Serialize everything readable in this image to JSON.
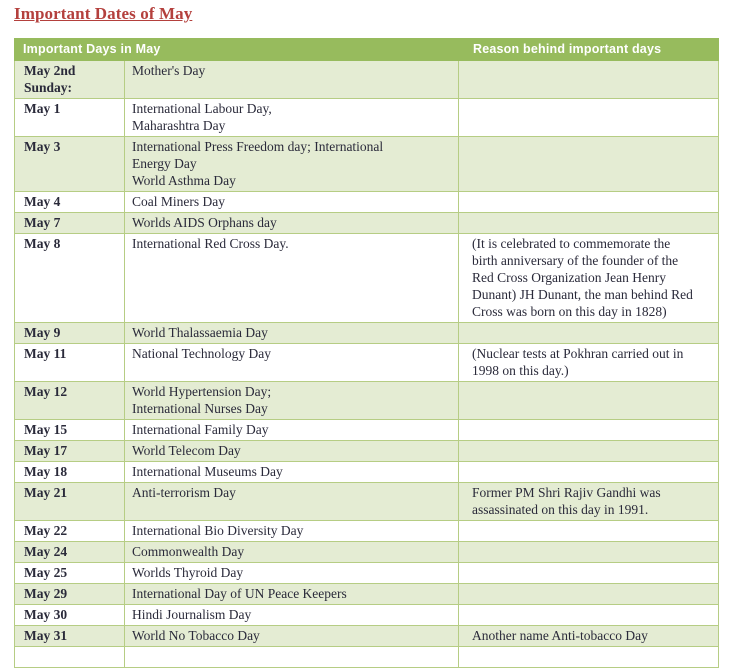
{
  "page": {
    "title": "Important Dates of May"
  },
  "table": {
    "columns": [
      {
        "key": "date",
        "label": "Important Days in May"
      },
      {
        "key": "event",
        "label": ""
      },
      {
        "key": "reason",
        "label": "Reason behind  important days"
      }
    ],
    "rows": [
      {
        "shade": true,
        "date": [
          "May 2nd",
          "Sunday:"
        ],
        "event": [
          "Mother's Day"
        ],
        "reason": []
      },
      {
        "shade": false,
        "date": [
          "May 1"
        ],
        "event": [
          "International Labour Day,",
          "Maharashtra Day"
        ],
        "reason": []
      },
      {
        "shade": true,
        "date": [
          "May 3"
        ],
        "event": [
          "International Press Freedom day; International",
          "Energy Day",
          "World Asthma Day"
        ],
        "reason": []
      },
      {
        "shade": false,
        "date": [
          "May 4"
        ],
        "event": [
          "Coal Miners Day"
        ],
        "reason": []
      },
      {
        "shade": true,
        "date": [
          "May 7"
        ],
        "event": [
          "Worlds AIDS Orphans day"
        ],
        "reason": []
      },
      {
        "shade": false,
        "date": [
          "May 8"
        ],
        "event": [
          "International Red Cross Day."
        ],
        "reason": [
          "(It is celebrated to commemorate the",
          "birth anniversary of the founder of the",
          "Red Cross Organization Jean Henry",
          "Dunant) JH Dunant, the man behind Red",
          "Cross was born on this day in 1828)"
        ]
      },
      {
        "shade": true,
        "date": [
          "May 9"
        ],
        "event": [
          "World Thalassaemia Day"
        ],
        "reason": []
      },
      {
        "shade": false,
        "date": [
          "May 11"
        ],
        "event": [
          "National Technology Day"
        ],
        "reason": [
          "(Nuclear tests at Pokhran carried out in",
          "1998 on this day.)"
        ]
      },
      {
        "shade": true,
        "date": [
          "May 12"
        ],
        "event": [
          "World Hypertension Day;",
          " International Nurses Day"
        ],
        "reason": []
      },
      {
        "shade": false,
        "date": [
          "May 15"
        ],
        "event": [
          "International Family Day"
        ],
        "reason": []
      },
      {
        "shade": true,
        "date": [
          "May 17"
        ],
        "event": [
          "World Telecom Day"
        ],
        "reason": []
      },
      {
        "shade": false,
        "date": [
          "May 18"
        ],
        "event": [
          "International Museums Day"
        ],
        "reason": []
      },
      {
        "shade": true,
        "date": [
          "May 21"
        ],
        "event": [
          "Anti-terrorism Day"
        ],
        "reason": [
          "Former PM Shri Rajiv Gandhi was",
          "assassinated on this day in 1991."
        ]
      },
      {
        "shade": false,
        "date": [
          "May 22"
        ],
        "event": [
          "International Bio Diversity Day"
        ],
        "reason": []
      },
      {
        "shade": true,
        "date": [
          "May 24"
        ],
        "event": [
          "Commonwealth Day"
        ],
        "reason": []
      },
      {
        "shade": false,
        "date": [
          "May 25"
        ],
        "event": [
          "Worlds Thyroid Day"
        ],
        "reason": []
      },
      {
        "shade": true,
        "date": [
          "May 29"
        ],
        "event": [
          "International Day of UN Peace Keepers"
        ],
        "reason": []
      },
      {
        "shade": false,
        "date": [
          "May 30"
        ],
        "event": [
          "Hindi Journalism Day"
        ],
        "reason": []
      },
      {
        "shade": true,
        "date": [
          "May 31"
        ],
        "event": [
          "World No Tobacco Day"
        ],
        "reason": [
          "Another name Anti-tobacco Day"
        ]
      },
      {
        "shade": false,
        "date": [],
        "event": [],
        "reason": []
      }
    ]
  },
  "colors": {
    "title": "#b4403d",
    "header_bg": "#97bb5d",
    "header_text": "#ffffff",
    "row_shade": "#e4ecd3",
    "row_plain": "#ffffff",
    "border": "#b6cd84",
    "body_text": "#2a2a3a"
  }
}
